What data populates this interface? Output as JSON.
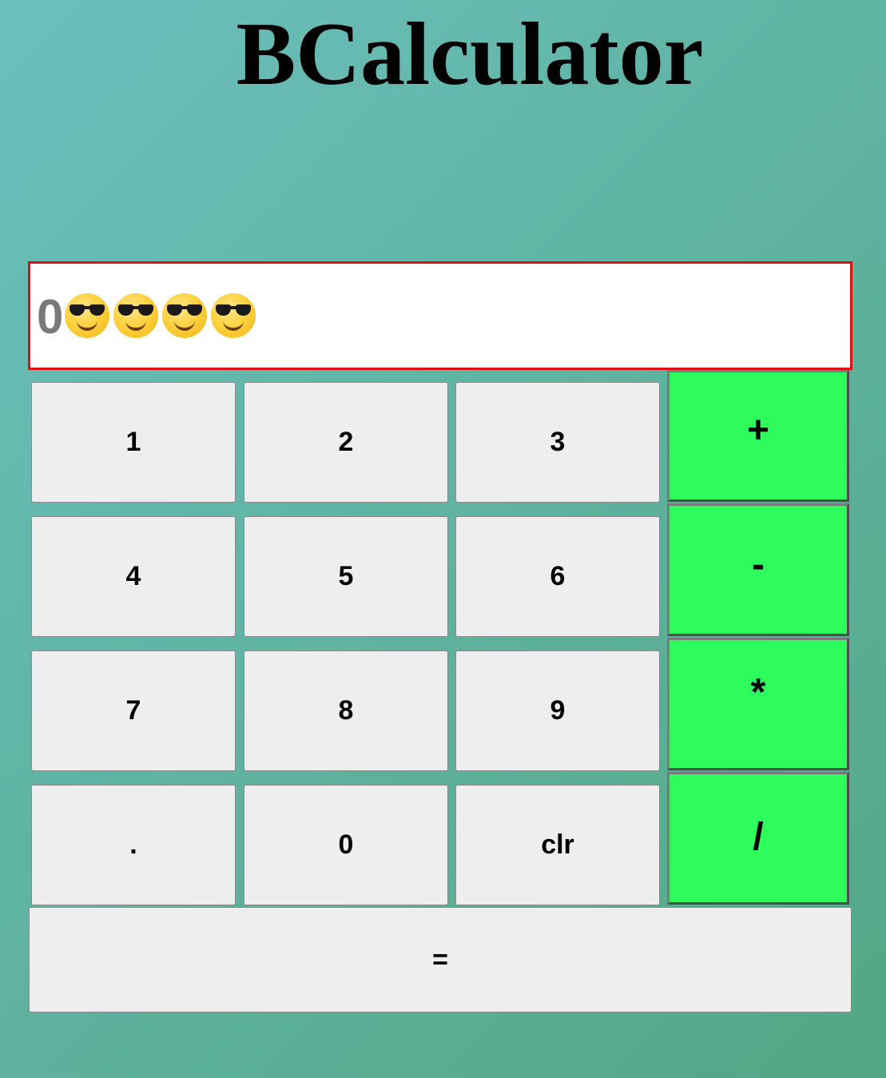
{
  "app": {
    "title": "BCalculator"
  },
  "display": {
    "value": "0",
    "emoji_icon": "smiling-face-with-sunglasses-icon",
    "emoji_count": 4
  },
  "keys": {
    "k1": "1",
    "k2": "2",
    "k3": "3",
    "k4": "4",
    "k5": "5",
    "k6": "6",
    "k7": "7",
    "k8": "8",
    "k9": "9",
    "dot": ".",
    "k0": "0",
    "clr": "clr",
    "equals": "="
  },
  "operators": {
    "plus": "+",
    "minus": "-",
    "multiply": "*",
    "divide": "/"
  },
  "colors": {
    "operator_bg": "#2efc5d",
    "display_border": "#e01010",
    "key_bg": "#eeeeee"
  }
}
